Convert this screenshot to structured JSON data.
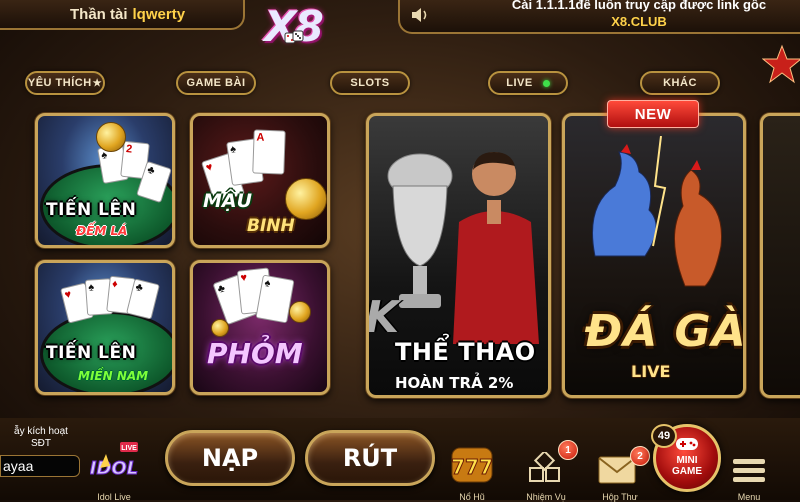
{
  "header": {
    "username_prefix": "Thần tài",
    "username": "lqwerty",
    "marquee": "Cài 1.1.1.1để luôn truy cập được link gốc",
    "brand_link": "X8.CLUB",
    "logo": "X8"
  },
  "tabs": [
    {
      "label": "YÊU THÍCH",
      "icon": "star-icon"
    },
    {
      "label": "GAME BÀI"
    },
    {
      "label": "SLOTS"
    },
    {
      "label": "LIVE",
      "icon": "live-dot-icon",
      "dot_color": "#3fe04a"
    },
    {
      "label": "KHÁC"
    }
  ],
  "games": {
    "tien_len_dem_la": {
      "title": "TIẾN LÊN",
      "subtitle": "ĐẾM LÁ"
    },
    "mau_binh": {
      "title": "MẬU",
      "subtitle": "BINH"
    },
    "tien_len_mien_nam": {
      "title": "TIẾN LÊN",
      "subtitle": "MIỀN NAM"
    },
    "phom": {
      "title": "PHỎM"
    },
    "the_thao": {
      "prefix": "K",
      "title": "THỂ THAO",
      "subtitle": "HOÀN TRẢ 2%"
    },
    "da_ga": {
      "badge": "NEW",
      "title": "ĐÁ GÀ",
      "subtitle": "LIVE"
    }
  },
  "login": {
    "hint_line1": "ẫy kích hoạt",
    "hint_line2": "SĐT",
    "value": "ayaa"
  },
  "bottom": {
    "idol_live_label": "Idol Live",
    "deposit_label": "NẠP",
    "withdraw_label": "RÚT",
    "jackpot_label": "Nổ Hũ",
    "mission_label": "Nhiệm Vụ",
    "mission_count": "1",
    "mail_label": "Hộp Thư",
    "mail_count": "2",
    "minigame_count": "49",
    "minigame_line1": "MINI",
    "minigame_line2": "GAME",
    "menu_label": "Menu"
  },
  "colors": {
    "gold": "#c9a55a",
    "accent_yellow": "#ffd24a",
    "new_badge": "#e02a1f",
    "live_dot": "#3fe04a"
  }
}
